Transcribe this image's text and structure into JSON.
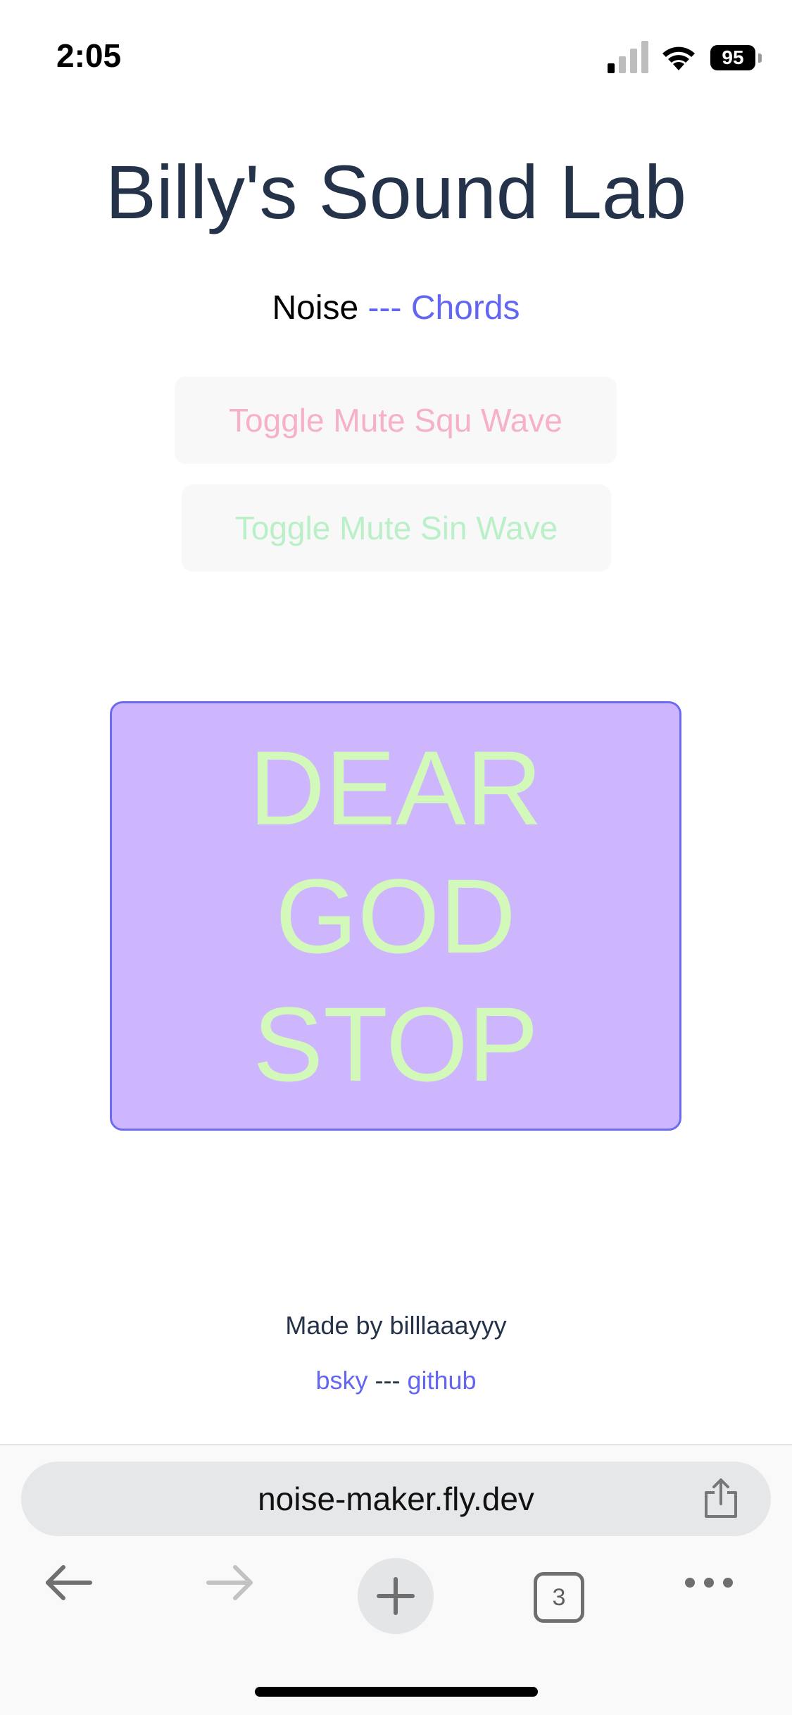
{
  "status_bar": {
    "time": "2:05",
    "battery": "95",
    "icons": [
      "cellular-signal-icon",
      "wifi-icon",
      "battery-icon"
    ]
  },
  "page": {
    "title": "Billy's Sound Lab",
    "nav": {
      "noise": "Noise",
      "separator": "---",
      "chords": "Chords"
    },
    "buttons": {
      "toggle_squ": "Toggle Mute Squ Wave",
      "toggle_sin": "Toggle Mute Sin Wave",
      "stop": "DEAR\nGOD\nSTOP"
    },
    "footer": {
      "made_by": "Made by billlaaayyy",
      "links": {
        "bsky": "bsky",
        "separator": "---",
        "github": "github"
      }
    }
  },
  "browser": {
    "url": "noise-maker.fly.dev",
    "tab_count": "3",
    "icons": [
      "share-icon",
      "back-arrow-icon",
      "forward-arrow-icon",
      "plus-icon",
      "tabs-icon",
      "more-icon"
    ]
  },
  "colors": {
    "title": "#24334a",
    "link": "#6366f1",
    "squ_text": "#f6b1c8",
    "sin_text": "#b9f0c8",
    "stop_bg": "#cdb6fd",
    "stop_border": "#6c6cf0",
    "stop_text": "#d2f9b9"
  }
}
